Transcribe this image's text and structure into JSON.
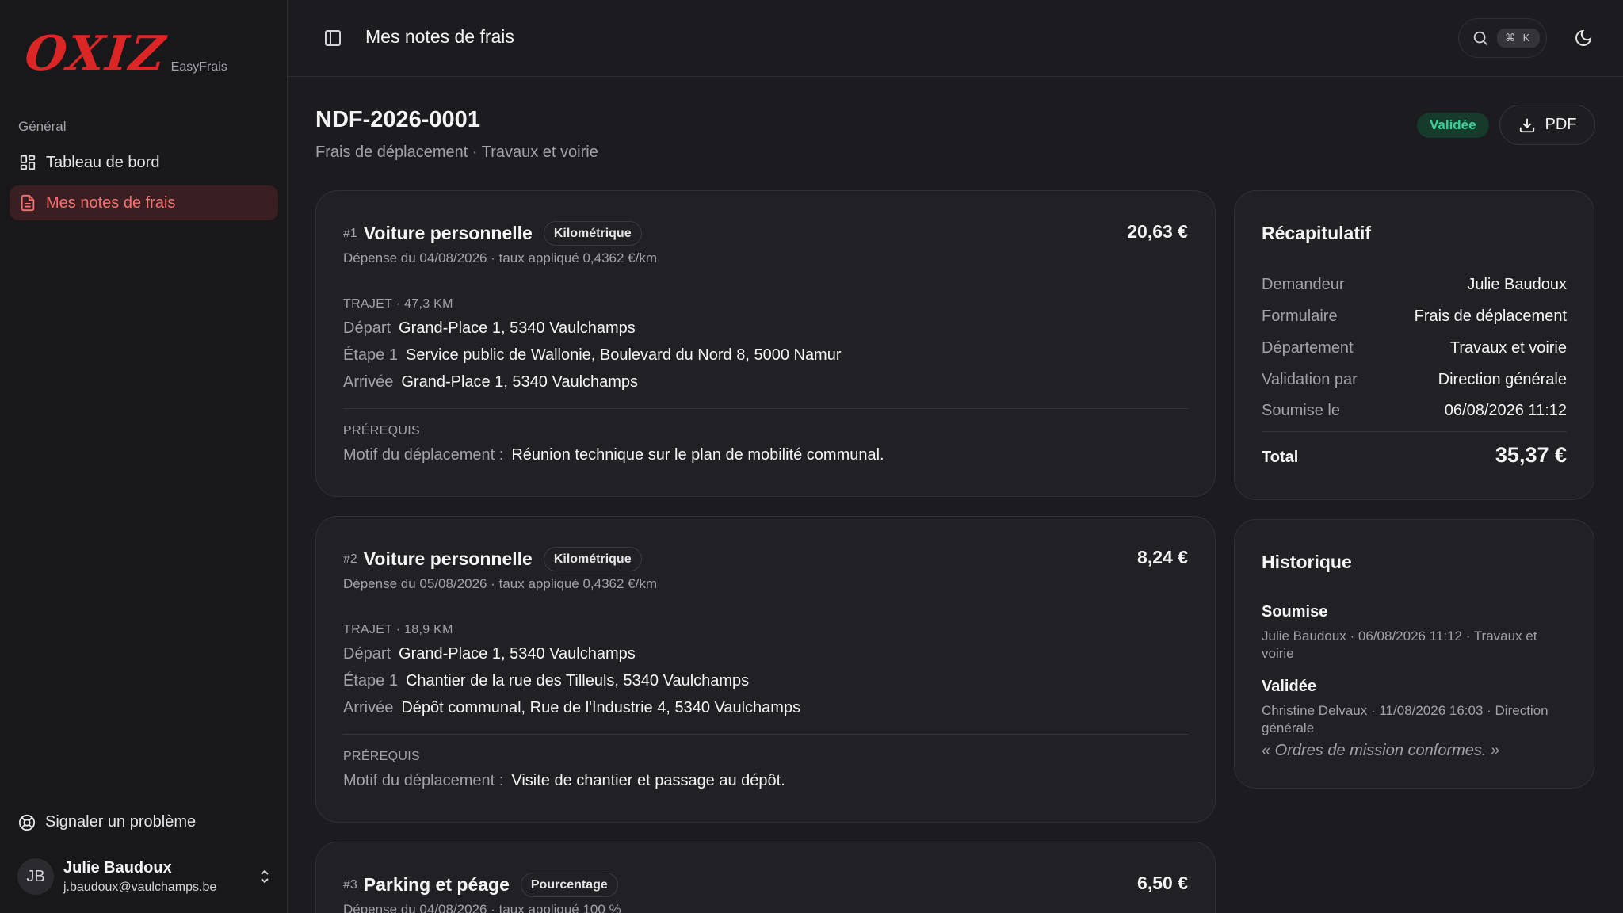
{
  "app": {
    "logo_text": "OXIZ",
    "logo_sub": "EasyFrais"
  },
  "sidebar": {
    "group_label": "Général",
    "items": [
      {
        "label": "Tableau de bord",
        "icon": "dashboard-icon",
        "active": false
      },
      {
        "label": "Mes notes de frais",
        "icon": "document-icon",
        "active": true
      }
    ],
    "report_label": "Signaler un problème",
    "user": {
      "initials": "JB",
      "name": "Julie Baudoux",
      "email": "j.baudoux@vaulchamps.be"
    }
  },
  "topbar": {
    "title": "Mes notes de frais",
    "search_shortcut": "⌘ K"
  },
  "note": {
    "id": "NDF-2026-0001",
    "subtitle": "Frais de déplacement · Travaux et voirie",
    "status": "Validée",
    "pdf_label": "PDF"
  },
  "expenses": [
    {
      "num": "#1",
      "title": "Voiture personnelle",
      "type": "Kilométrique",
      "amount": "20,63 €",
      "meta": "Dépense du 04/08/2026 · taux appliqué 0,4362 €/km",
      "trip_label": "TRAJET · 47,3 KM",
      "stops": [
        {
          "k": "Départ",
          "v": "Grand-Place 1, 5340 Vaulchamps"
        },
        {
          "k": "Étape 1",
          "v": "Service public de Wallonie, Boulevard du Nord 8, 5000 Namur"
        },
        {
          "k": "Arrivée",
          "v": "Grand-Place 1, 5340 Vaulchamps"
        }
      ],
      "prereq_label": "PRÉREQUIS",
      "prereq": {
        "k": "Motif du déplacement :",
        "v": "Réunion technique sur le plan de mobilité communal."
      }
    },
    {
      "num": "#2",
      "title": "Voiture personnelle",
      "type": "Kilométrique",
      "amount": "8,24 €",
      "meta": "Dépense du 05/08/2026 · taux appliqué 0,4362 €/km",
      "trip_label": "TRAJET · 18,9 KM",
      "stops": [
        {
          "k": "Départ",
          "v": "Grand-Place 1, 5340 Vaulchamps"
        },
        {
          "k": "Étape 1",
          "v": "Chantier de la rue des Tilleuls, 5340 Vaulchamps"
        },
        {
          "k": "Arrivée",
          "v": "Dépôt communal, Rue de l'Industrie 4, 5340 Vaulchamps"
        }
      ],
      "prereq_label": "PRÉREQUIS",
      "prereq": {
        "k": "Motif du déplacement :",
        "v": "Visite de chantier et passage au dépôt."
      }
    },
    {
      "num": "#3",
      "title": "Parking et péage",
      "type": "Pourcentage",
      "amount": "6,50 €",
      "meta": "Dépense du 04/08/2026 · taux appliqué 100 %"
    }
  ],
  "recap": {
    "title": "Récapitulatif",
    "rows": [
      {
        "k": "Demandeur",
        "v": "Julie Baudoux"
      },
      {
        "k": "Formulaire",
        "v": "Frais de déplacement"
      },
      {
        "k": "Département",
        "v": "Travaux et voirie"
      },
      {
        "k": "Validation par",
        "v": "Direction générale"
      },
      {
        "k": "Soumise le",
        "v": "06/08/2026 11:12"
      }
    ],
    "total_label": "Total",
    "total_value": "35,37 €"
  },
  "history": {
    "title": "Historique",
    "items": [
      {
        "title": "Soumise",
        "detail": "Julie Baudoux · 06/08/2026 11:12 · Travaux et voirie",
        "comment": ""
      },
      {
        "title": "Validée",
        "detail": "Christine Delvaux · 11/08/2026 16:03 · Direction générale",
        "comment": "« Ordres de mission conformes. »"
      }
    ]
  },
  "colors": {
    "accent": "#dc2626",
    "active_nav_bg": "#3a1f22",
    "active_nav_text": "#f87171",
    "status_bg": "#163a2b",
    "status_text": "#34d399"
  }
}
